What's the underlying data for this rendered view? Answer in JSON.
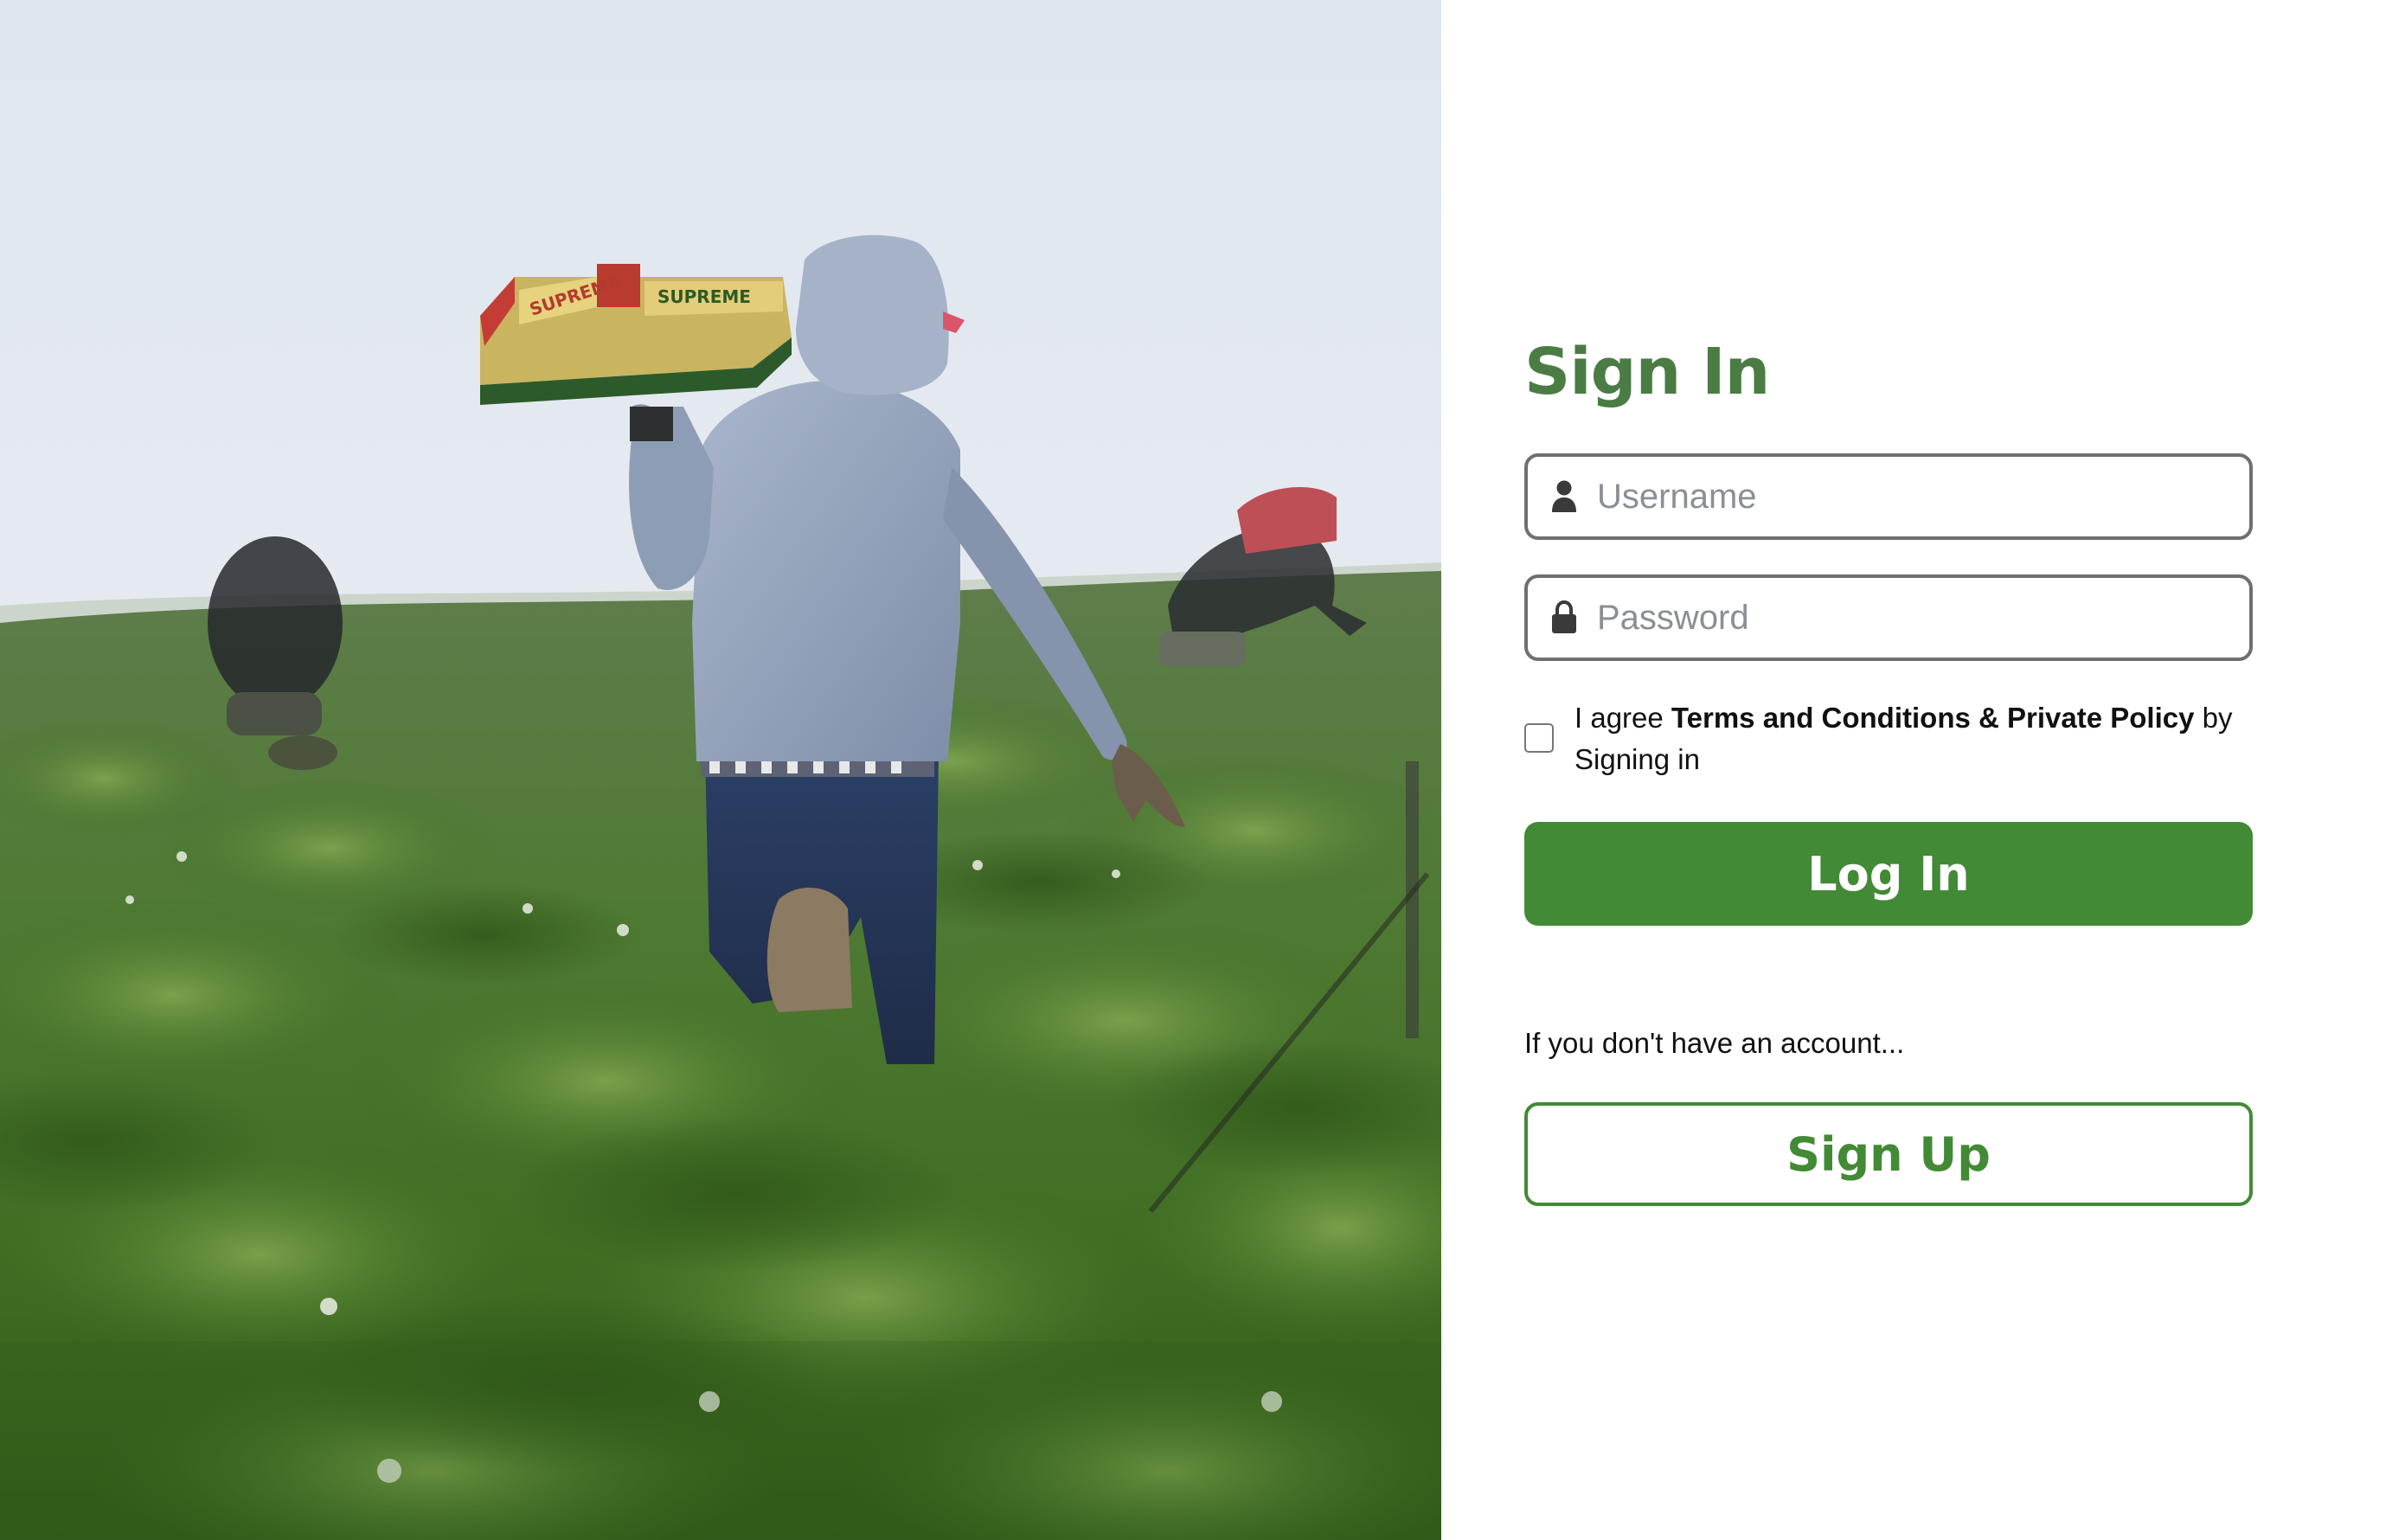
{
  "photo": {
    "alt": "Farm workers picking in a field",
    "box_print_1": "SUPREME",
    "box_print_2": "SUPREME"
  },
  "signin": {
    "title": "Sign In",
    "username": {
      "placeholder": "Username",
      "value": "",
      "icon": "user-icon"
    },
    "password": {
      "placeholder": "Password",
      "value": "",
      "icon": "lock-icon"
    },
    "agree": {
      "checked": false,
      "prefix": "I agree ",
      "terms_label": "Terms and Conditions & Private Policy",
      "suffix": " by Signing in"
    },
    "login_label": "Log In",
    "no_account_text": "If you don't have an account...",
    "signup_label": "Sign Up"
  },
  "colors": {
    "brand_green": "#428a35",
    "title_green": "#4a7c44",
    "field_border": "#6f6f6f",
    "placeholder_gray": "#8a8f96"
  }
}
